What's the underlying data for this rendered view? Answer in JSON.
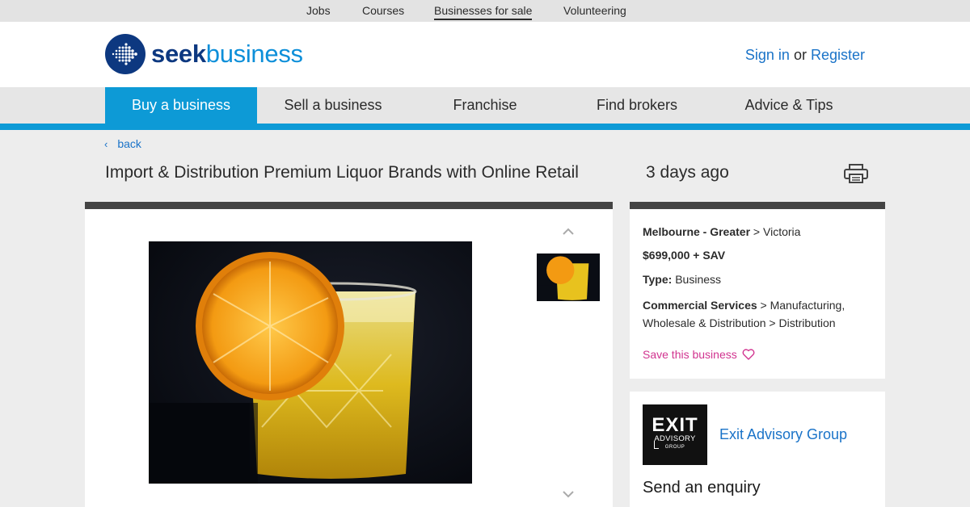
{
  "topnav": [
    {
      "label": "Jobs",
      "active": false
    },
    {
      "label": "Courses",
      "active": false
    },
    {
      "label": "Businesses for sale",
      "active": true
    },
    {
      "label": "Volunteering",
      "active": false
    }
  ],
  "header": {
    "logo_seek": "seek",
    "logo_business": "business",
    "sign_in": "Sign in",
    "or": "or",
    "register": "Register"
  },
  "mainnav": [
    {
      "label": "Buy a business",
      "active": true
    },
    {
      "label": "Sell a business",
      "active": false
    },
    {
      "label": "Franchise",
      "active": false
    },
    {
      "label": "Find brokers",
      "active": false
    },
    {
      "label": "Advice & Tips",
      "active": false
    }
  ],
  "listing": {
    "back_label": "back",
    "title": "Import & Distribution Premium Liquor Brands with Online Retail",
    "posted": "3 days ago",
    "location_area": "Melbourne - Greater",
    "location_state": "Victoria",
    "price": "$699,000 + SAV",
    "type_label": "Type:",
    "type_value": "Business",
    "category": "Commercial Services",
    "subcategory": "Manufacturing, Wholesale & Distribution",
    "subsubcategory": "Distribution",
    "save_label": "Save this business"
  },
  "agent": {
    "logo_main": "EXIT",
    "logo_sub": "ADVISORY",
    "logo_group": "GROUP",
    "name": "Exit Advisory Group",
    "enquiry_title": "Send an enquiry"
  },
  "icons": {
    "print": "printer-icon",
    "heart": "heart-outline-icon",
    "up": "chevron-up-icon",
    "down": "chevron-down-icon",
    "back": "chevron-left-icon"
  },
  "colors": {
    "accent": "#0d9ad6",
    "link": "#1a73c8",
    "save": "#d1338f",
    "logo_dark": "#0d3880"
  }
}
